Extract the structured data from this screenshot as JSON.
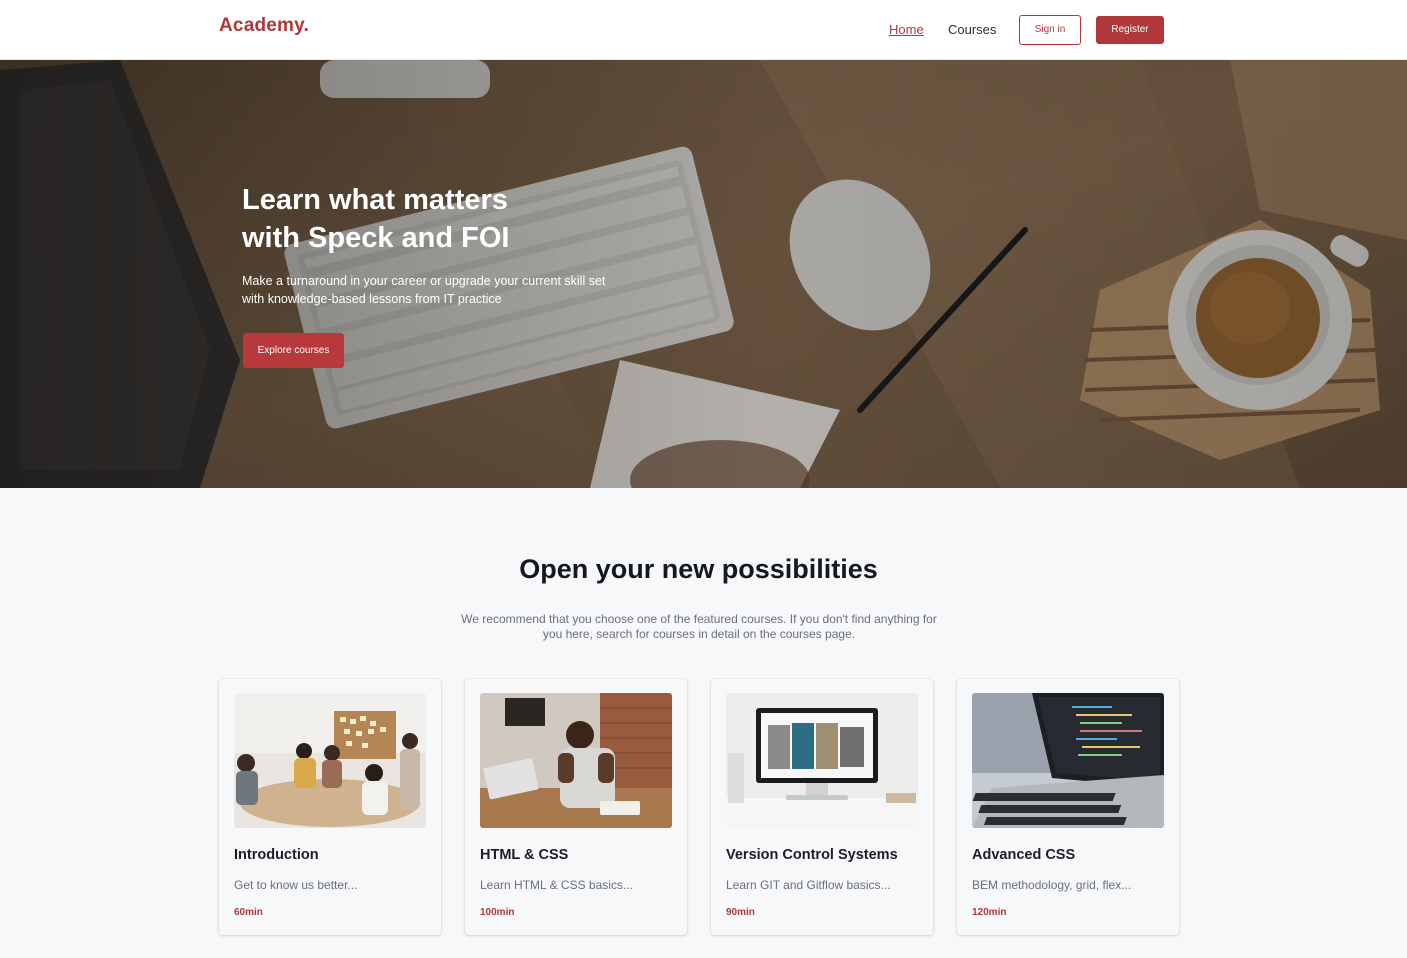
{
  "header": {
    "logo": "Academy",
    "logo_dot": ".",
    "nav": {
      "home": "Home",
      "courses": "Courses"
    },
    "sign_in": "Sign in",
    "register": "Register"
  },
  "hero": {
    "title_line1": "Learn what matters",
    "title_line2": "with Speck and FOI",
    "subtitle_line1": "Make a turnaround in your career or upgrade your current skill set",
    "subtitle_line2": "with knowledge-based lessons from IT practice",
    "cta": "Explore courses"
  },
  "section": {
    "title": "Open your new possibilities",
    "description_line1": "We recommend that you choose one of the featured courses. If you don't find anything for",
    "description_line2": "you here, search for courses in detail on the courses page."
  },
  "courses": [
    {
      "title": "Introduction",
      "description": "Get to know us better...",
      "duration": "60min"
    },
    {
      "title": "HTML & CSS",
      "description": "Learn HTML & CSS basics...",
      "duration": "100min"
    },
    {
      "title": "Version Control Systems",
      "description": "Learn GIT and Gitflow basics...",
      "duration": "90min"
    },
    {
      "title": "Advanced CSS",
      "description": "BEM methodology, grid, flex...",
      "duration": "120min"
    }
  ],
  "colors": {
    "brand": "#b1373a",
    "page_background": "#f7f8fa",
    "header_background": "#ffffff"
  }
}
